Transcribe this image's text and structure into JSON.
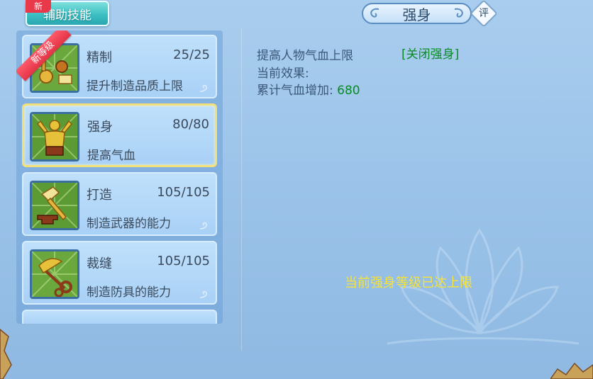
{
  "tab": {
    "label": "辅助技能",
    "new_badge": "新"
  },
  "skills": [
    {
      "name": "精制",
      "level": "25/25",
      "desc": "提升制造品质上限",
      "ribbon": "新等级",
      "icon": "crafting-tools-icon"
    },
    {
      "name": "强身",
      "level": "80/80",
      "desc": "提高气血",
      "icon": "muscle-man-icon"
    },
    {
      "name": "打造",
      "level": "105/105",
      "desc": "制造武器的能力",
      "icon": "hammer-anvil-icon"
    },
    {
      "name": "裁缝",
      "level": "105/105",
      "desc": "制造防具的能力",
      "icon": "scissors-icon"
    }
  ],
  "detail": {
    "title": "强身",
    "rate_label": "评",
    "line1": "提高人物气血上限",
    "close_link": "[关闭强身]",
    "line2": "当前效果:",
    "line3_label": "累计气血增加:",
    "line3_value": "680",
    "max_message": "当前强身等级已达上限"
  },
  "colors": {
    "accent_green": "#0a8a25",
    "max_yellow": "#f6e33a",
    "new_red": "#e8384a",
    "selected_border": "#f2e07a"
  }
}
